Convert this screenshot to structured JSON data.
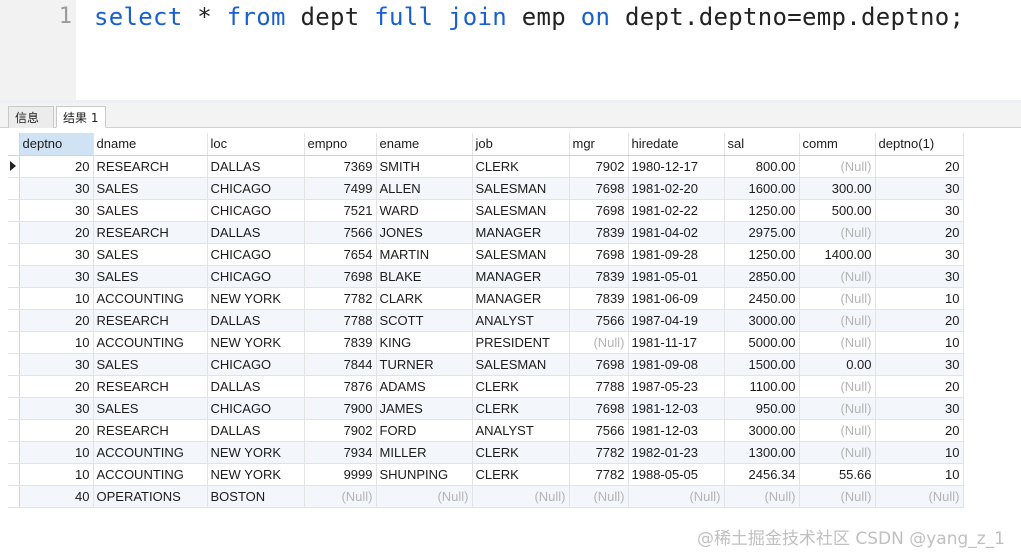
{
  "editor": {
    "line_number": "1",
    "tokens": [
      {
        "text": "select",
        "type": "kw"
      },
      {
        "text": " * ",
        "type": "pl"
      },
      {
        "text": "from",
        "type": "kw"
      },
      {
        "text": " dept ",
        "type": "pl"
      },
      {
        "text": "full",
        "type": "kw"
      },
      {
        "text": " ",
        "type": "pl"
      },
      {
        "text": "join",
        "type": "kw"
      },
      {
        "text": " emp ",
        "type": "pl"
      },
      {
        "text": "on",
        "type": "kw"
      },
      {
        "text": " dept.deptno=emp.deptno;",
        "type": "pl"
      }
    ],
    "keyword_color": "#1a5fd0"
  },
  "tabs": {
    "info": "信息",
    "result": "结果 1"
  },
  "grid": {
    "columns": [
      {
        "label": "deptno",
        "width": 74,
        "align": "num"
      },
      {
        "label": "dname",
        "width": 114,
        "align": "left"
      },
      {
        "label": "loc",
        "width": 97,
        "align": "left"
      },
      {
        "label": "empno",
        "width": 72,
        "align": "num"
      },
      {
        "label": "ename",
        "width": 96,
        "align": "left"
      },
      {
        "label": "job",
        "width": 97,
        "align": "left"
      },
      {
        "label": "mgr",
        "width": 59,
        "align": "num"
      },
      {
        "label": "hiredate",
        "width": 96,
        "align": "left"
      },
      {
        "label": "sal",
        "width": 75,
        "align": "num"
      },
      {
        "label": "comm",
        "width": 76,
        "align": "num"
      },
      {
        "label": "deptno(1)",
        "width": 88,
        "align": "num"
      }
    ],
    "null_text": "(Null)",
    "rows": [
      [
        "20",
        "RESEARCH",
        "DALLAS",
        "7369",
        "SMITH",
        "CLERK",
        "7902",
        "1980-12-17",
        "800.00",
        null,
        "20"
      ],
      [
        "30",
        "SALES",
        "CHICAGO",
        "7499",
        "ALLEN",
        "SALESMAN",
        "7698",
        "1981-02-20",
        "1600.00",
        "300.00",
        "30"
      ],
      [
        "30",
        "SALES",
        "CHICAGO",
        "7521",
        "WARD",
        "SALESMAN",
        "7698",
        "1981-02-22",
        "1250.00",
        "500.00",
        "30"
      ],
      [
        "20",
        "RESEARCH",
        "DALLAS",
        "7566",
        "JONES",
        "MANAGER",
        "7839",
        "1981-04-02",
        "2975.00",
        null,
        "20"
      ],
      [
        "30",
        "SALES",
        "CHICAGO",
        "7654",
        "MARTIN",
        "SALESMAN",
        "7698",
        "1981-09-28",
        "1250.00",
        "1400.00",
        "30"
      ],
      [
        "30",
        "SALES",
        "CHICAGO",
        "7698",
        "BLAKE",
        "MANAGER",
        "7839",
        "1981-05-01",
        "2850.00",
        null,
        "30"
      ],
      [
        "10",
        "ACCOUNTING",
        "NEW YORK",
        "7782",
        "CLARK",
        "MANAGER",
        "7839",
        "1981-06-09",
        "2450.00",
        null,
        "10"
      ],
      [
        "20",
        "RESEARCH",
        "DALLAS",
        "7788",
        "SCOTT",
        "ANALYST",
        "7566",
        "1987-04-19",
        "3000.00",
        null,
        "20"
      ],
      [
        "10",
        "ACCOUNTING",
        "NEW YORK",
        "7839",
        "KING",
        "PRESIDENT",
        null,
        "1981-11-17",
        "5000.00",
        null,
        "10"
      ],
      [
        "30",
        "SALES",
        "CHICAGO",
        "7844",
        "TURNER",
        "SALESMAN",
        "7698",
        "1981-09-08",
        "1500.00",
        "0.00",
        "30"
      ],
      [
        "20",
        "RESEARCH",
        "DALLAS",
        "7876",
        "ADAMS",
        "CLERK",
        "7788",
        "1987-05-23",
        "1100.00",
        null,
        "20"
      ],
      [
        "30",
        "SALES",
        "CHICAGO",
        "7900",
        "JAMES",
        "CLERK",
        "7698",
        "1981-12-03",
        "950.00",
        null,
        "30"
      ],
      [
        "20",
        "RESEARCH",
        "DALLAS",
        "7902",
        "FORD",
        "ANALYST",
        "7566",
        "1981-12-03",
        "3000.00",
        null,
        "20"
      ],
      [
        "10",
        "ACCOUNTING",
        "NEW YORK",
        "7934",
        "MILLER",
        "CLERK",
        "7782",
        "1982-01-23",
        "1300.00",
        null,
        "10"
      ],
      [
        "10",
        "ACCOUNTING",
        "NEW YORK",
        "9999",
        "SHUNPING",
        "CLERK",
        "7782",
        "1988-05-05",
        "2456.34",
        "55.66",
        "10"
      ],
      [
        "40",
        "OPERATIONS",
        "BOSTON",
        null,
        null,
        null,
        null,
        null,
        null,
        null,
        null
      ]
    ]
  },
  "watermark": "@稀土掘金技术社区 CSDN @yang_z_1"
}
